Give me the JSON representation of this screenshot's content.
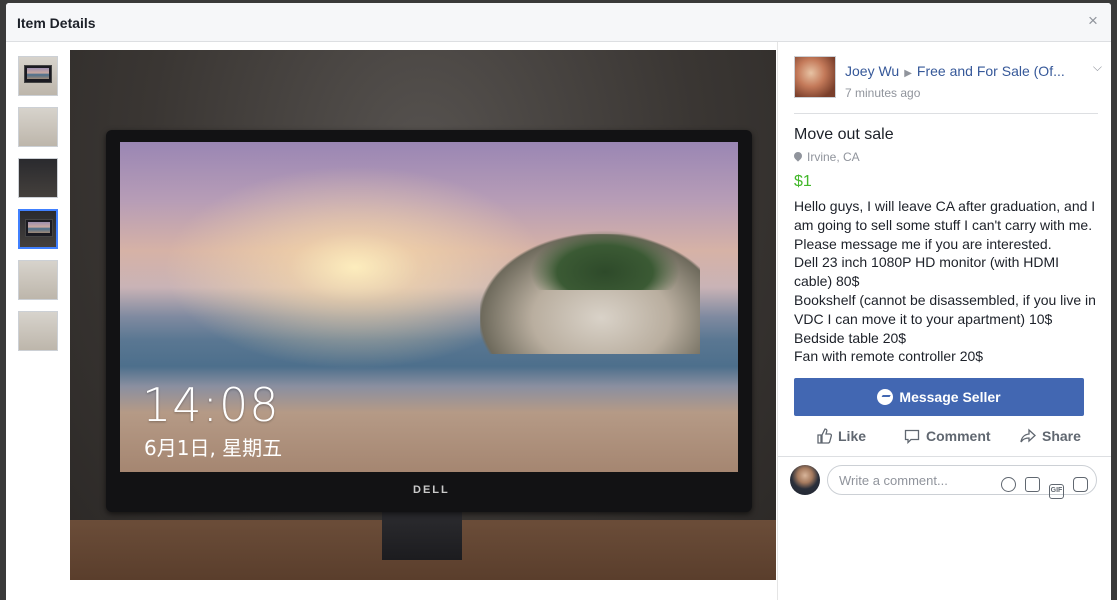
{
  "dialog": {
    "title": "Item Details",
    "close_symbol": "×"
  },
  "thumbnails": [
    {
      "name": "thumb-1",
      "selected": false
    },
    {
      "name": "thumb-2",
      "selected": false
    },
    {
      "name": "thumb-3",
      "selected": false
    },
    {
      "name": "thumb-4",
      "selected": true
    },
    {
      "name": "thumb-5",
      "selected": false
    },
    {
      "name": "thumb-6",
      "selected": false
    }
  ],
  "photo": {
    "clock": "14:08",
    "date": "6月1日, 星期五",
    "logo": "DELL"
  },
  "post": {
    "author": "Joey Wu",
    "group": "Free and For Sale (Of...",
    "time": "7 minutes ago",
    "title": "Move out sale",
    "location": "Irvine, CA",
    "price": "$1",
    "description_lines": [
      "Hello guys, I will leave CA after graduation, and I",
      "am going to sell some stuff I can't carry with me.",
      "Please message me if you are interested.",
      "Dell 23 inch 1080P HD monitor (with HDMI",
      "cable) 80$",
      "Bookshelf (cannot be disassembled, if you live in",
      "VDC I can move it to your apartment) 10$",
      "Bedside table 20$",
      "Fan with remote controller 20$"
    ]
  },
  "buttons": {
    "message_seller": "Message Seller",
    "like": "Like",
    "comment": "Comment",
    "share": "Share"
  },
  "comment_box": {
    "placeholder": "Write a comment..."
  },
  "icons": [
    "close-icon",
    "chevron-down-icon",
    "location-pin-icon",
    "messenger-icon",
    "like-icon",
    "comment-icon",
    "share-icon",
    "emoji-icon",
    "camera-icon",
    "gif-icon",
    "sticker-icon"
  ],
  "colors": {
    "link": "#365899",
    "price": "#42b72a",
    "primary_button": "#4267b2",
    "selected_thumb": "#4080ff"
  }
}
